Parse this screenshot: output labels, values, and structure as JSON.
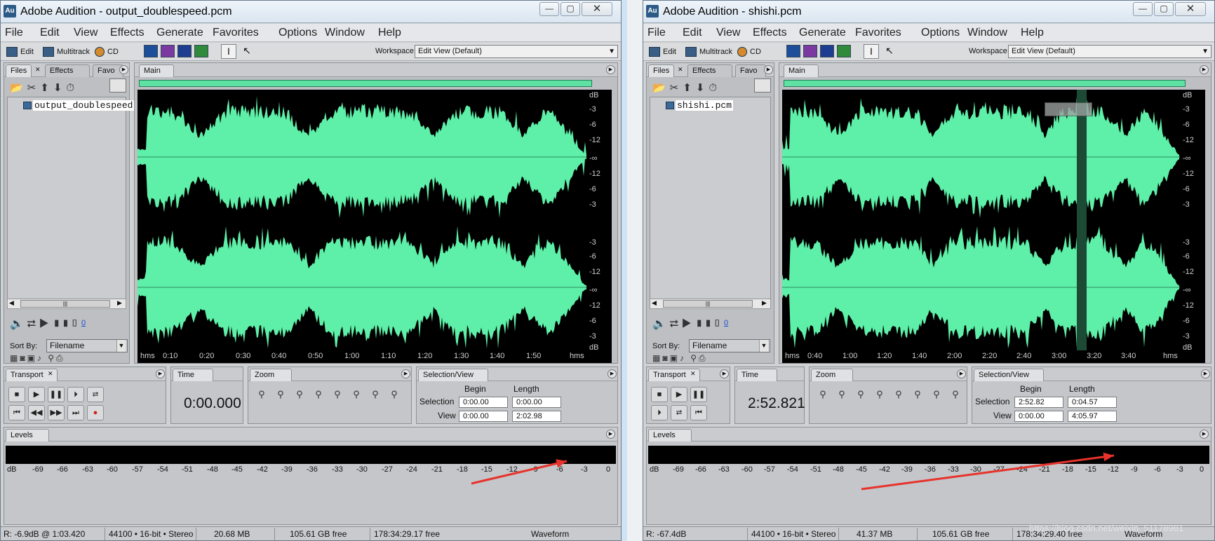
{
  "left": {
    "title": "Adobe Audition - output_doublespeed.pcm",
    "app_icon": "Au",
    "controls": {
      "minimize": "—",
      "maximize": "▢",
      "close": "✕"
    },
    "menu": [
      "File",
      "Edit",
      "View",
      "Effects",
      "Generate",
      "Favorites",
      "Options",
      "Window",
      "Help"
    ],
    "toolbar": {
      "edit": "Edit",
      "multitrack": "Multitrack",
      "cd": "CD",
      "workspace_label": "Workspace:",
      "workspace_value": "Edit View (Default)"
    },
    "files_tabs": [
      "Files",
      "Effects",
      "Favo"
    ],
    "file_item": "output_doublespeed.p",
    "zero_link": "0",
    "sort_by_label": "Sort By:",
    "sort_by_value": "Filename",
    "main_tab": "Main",
    "db_top": [
      "dB",
      "-3",
      "-6",
      "-12",
      "-∞",
      "-12",
      "-6",
      "-3"
    ],
    "db_bottom": [
      "-3",
      "-6",
      "-12",
      "-∞",
      "-12",
      "-6",
      "-3",
      "dB"
    ],
    "time_ticks": [
      "hms",
      "0:10",
      "0:20",
      "0:30",
      "0:40",
      "0:50",
      "1:00",
      "1:10",
      "1:20",
      "1:30",
      "1:40",
      "1:50",
      "hms"
    ],
    "transport_tab": "Transport",
    "time_tab": "Time",
    "zoom_tab": "Zoom",
    "selview_tab": "Selection/View",
    "time_value": "0:00.000",
    "selview": {
      "begin": "Begin",
      "length": "Length",
      "selection": "Selection",
      "view": "View",
      "sel_begin": "0:00.00",
      "sel_length": "0:00.00",
      "view_begin": "0:00.00",
      "view_length": "2:02.98"
    },
    "levels_tab": "Levels",
    "level_scale": [
      "dB",
      "-69",
      "-66",
      "-63",
      "-60",
      "-57",
      "-54",
      "-51",
      "-48",
      "-45",
      "-42",
      "-39",
      "-36",
      "-33",
      "-30",
      "-27",
      "-24",
      "-21",
      "-18",
      "-15",
      "-12",
      "-9",
      "-6",
      "-3",
      "0"
    ],
    "status": {
      "r": "R: -6.9dB @ 1:03.420",
      "format": "44100 • 16-bit • Stereo",
      "size": "20.68 MB",
      "free": "105.61 GB free",
      "time_free": "178:34:29.17 free",
      "view": "Waveform"
    }
  },
  "right": {
    "title": "Adobe Audition - shishi.pcm",
    "app_icon": "Au",
    "controls": {
      "minimize": "—",
      "maximize": "▢",
      "close": "✕"
    },
    "menu": [
      "File",
      "Edit",
      "View",
      "Effects",
      "Generate",
      "Favorites",
      "Options",
      "Window",
      "Help"
    ],
    "toolbar": {
      "edit": "Edit",
      "multitrack": "Multitrack",
      "cd": "CD",
      "workspace_label": "Workspace:",
      "workspace_value": "Edit View (Default)"
    },
    "files_tabs": [
      "Files",
      "Effects",
      "Favo"
    ],
    "file_item": "shishi.pcm",
    "zero_link": "0",
    "sort_by_label": "Sort By:",
    "sort_by_value": "Filename",
    "main_tab": "Main",
    "db_top": [
      "dB",
      "-3",
      "-6",
      "-12",
      "-∞",
      "-12",
      "-6",
      "-3"
    ],
    "db_bottom": [
      "-3",
      "-6",
      "-12",
      "-∞",
      "-12",
      "-6",
      "-3",
      "dB"
    ],
    "time_ticks": [
      "hms",
      "0:40",
      "1:00",
      "1:20",
      "1:40",
      "2:00",
      "2:20",
      "2:40",
      "3:00",
      "3:20",
      "3:40",
      "hms"
    ],
    "transport_tab": "Transport",
    "time_tab": "Time",
    "zoom_tab": "Zoom",
    "selview_tab": "Selection/View",
    "time_value": "2:52.821",
    "selview": {
      "begin": "Begin",
      "length": "Length",
      "selection": "Selection",
      "view": "View",
      "sel_begin": "2:52.82",
      "sel_length": "0:04.57",
      "view_begin": "0:00.00",
      "view_length": "4:05.97"
    },
    "levels_tab": "Levels",
    "level_scale": [
      "dB",
      "-69",
      "-66",
      "-63",
      "-60",
      "-57",
      "-54",
      "-51",
      "-48",
      "-45",
      "-42",
      "-39",
      "-36",
      "-33",
      "-30",
      "-27",
      "-24",
      "-21",
      "-18",
      "-15",
      "-12",
      "-9",
      "-6",
      "-3",
      "0"
    ],
    "status": {
      "r": "R: -67.4dB",
      "format": "44100 • 16-bit • Stereo",
      "size": "41.37 MB",
      "free": "105.61 GB free",
      "time_free": "178:34:29.40 free",
      "view": "Waveform"
    },
    "watermark": "https://blog.csdn.net/weixin_51178981"
  },
  "colors": {
    "waveform": "#5ef0a8",
    "waveform_bg": "#000000",
    "selection": "#1c4a34",
    "arrow": "#e8322b"
  }
}
